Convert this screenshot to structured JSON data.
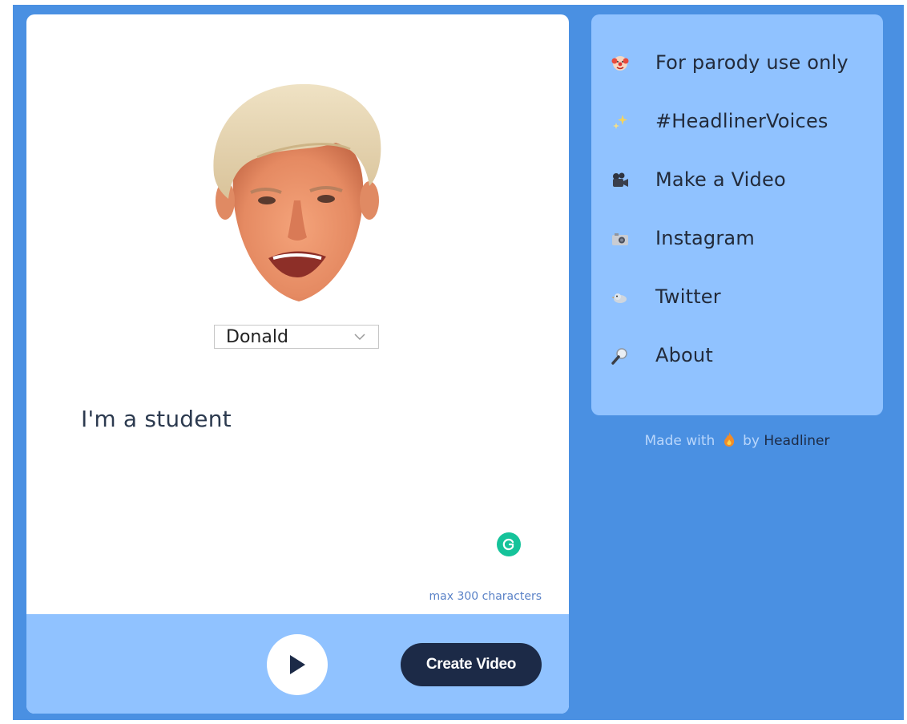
{
  "voice": {
    "selected": "Donald",
    "portrait_icon": "face-portrait"
  },
  "editor": {
    "text": "I'm a student",
    "limit_note": "max 300 characters",
    "grammarly_icon": "grammarly-icon"
  },
  "actions": {
    "play_icon": "play-icon",
    "create_label": "Create Video"
  },
  "menu": {
    "items": [
      {
        "icon": "clown-icon",
        "label": "For parody use only"
      },
      {
        "icon": "sparkles-icon",
        "label": "#HeadlinerVoices"
      },
      {
        "icon": "movie-camera-icon",
        "label": "Make a Video"
      },
      {
        "icon": "camera-icon",
        "label": "Instagram"
      },
      {
        "icon": "bird-icon",
        "label": "Twitter"
      },
      {
        "icon": "magnifier-icon",
        "label": "About"
      }
    ]
  },
  "credit": {
    "prefix": "Made with",
    "middle": "by",
    "brand": "Headliner",
    "icon": "fire-icon"
  },
  "colors": {
    "background": "#4a90e2",
    "panel": "#90c2ff",
    "button": "#1c2a47",
    "grammarly": "#15c39a"
  }
}
